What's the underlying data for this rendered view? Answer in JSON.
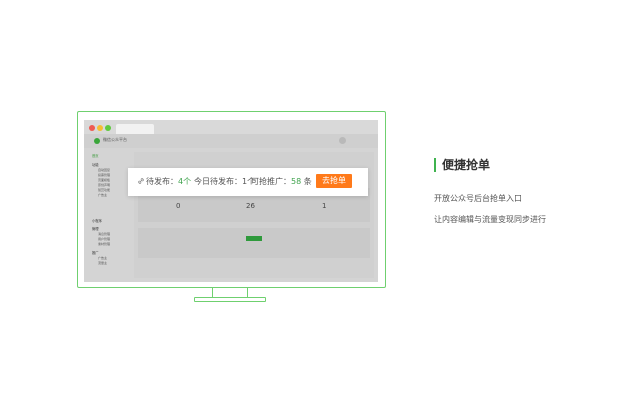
{
  "browser": {
    "app_title": "微信公众平台",
    "sidebar": [
      {
        "label": "首页",
        "main": true,
        "active": true
      },
      {
        "label": "功能",
        "main": true
      },
      {
        "label": "自动回复"
      },
      {
        "label": "投票管理"
      },
      {
        "label": "页面模板"
      },
      {
        "label": "原创声明"
      },
      {
        "label": "赞赏功能"
      },
      {
        "label": "广告主"
      },
      {
        "label": "小程序",
        "main": true
      },
      {
        "label": "管理",
        "main": true
      },
      {
        "label": "消息管理"
      },
      {
        "label": "用户管理"
      },
      {
        "label": "素材管理"
      },
      {
        "label": "推广",
        "main": true
      },
      {
        "label": "广告主"
      },
      {
        "label": "流量主"
      }
    ],
    "stats": [
      {
        "value": "0"
      },
      {
        "value": "26"
      },
      {
        "value": "1"
      }
    ]
  },
  "card": {
    "pending_label": "待发布：",
    "pending_value": "4个",
    "today_label": "今日待发布：",
    "today_value": "1个",
    "grab_label": "可抢推广：",
    "grab_value": "58",
    "grab_unit": "条",
    "button_label": "去抢单"
  },
  "feature": {
    "title": "便捷抢单",
    "line1": "开放公众号后台抢单入口",
    "line2": "让内容编辑与流量变现同步进行"
  },
  "colors": {
    "accent_green": "#3fb34f",
    "button_orange": "#ff7a1a"
  }
}
